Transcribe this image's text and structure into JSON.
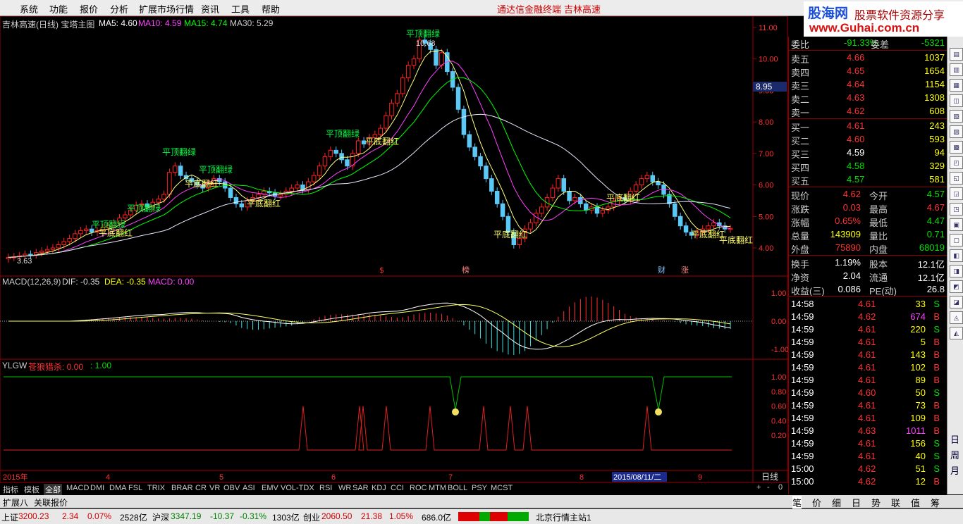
{
  "menu": {
    "items": [
      "系统",
      "功能",
      "报价",
      "分析",
      "扩展市场行情",
      "资讯",
      "工具",
      "帮助"
    ],
    "center_links": [
      "通达信金融终端",
      "吉林高速"
    ]
  },
  "logo": {
    "brand": "股海网",
    "slogan": "股票软件资源分享",
    "url": "www.Guhai.com.cn"
  },
  "chart": {
    "title": "吉林高速(日线) 宝塔主图",
    "ma": [
      {
        "label": "MA5: 4.60",
        "color": "#ffffff"
      },
      {
        "label": "MA10: 4.59",
        "color": "#ff40ff"
      },
      {
        "label": "MA15: 4.74",
        "color": "#00ff00"
      },
      {
        "label": "MA30: 5.29",
        "color": "#ffffff"
      }
    ],
    "price_axis": [
      "11.00",
      "10.00",
      "9.00",
      "8.00",
      "7.00",
      "6.00",
      "5.00",
      "4.00"
    ],
    "current_price_tag": "8.95",
    "high_label": "10.68",
    "low_label": "3.63",
    "annotations_top": [
      "平顶翻绿",
      "平顶翻绿",
      "平顶翻绿",
      "平顶翻绿",
      "平顶翻绿",
      "平顶翻绿"
    ],
    "annotations_bottom": [
      "平底翻红",
      "平底翻红",
      "平底翻红",
      "平底翻红",
      "平底翻红",
      "平底翻红",
      "平底翻红",
      "平底翻红"
    ],
    "event_marks": [
      "$",
      "榜",
      "财",
      "涨"
    ],
    "macd": {
      "label": "MACD(12,26,9)",
      "dif": "DIF: -0.35",
      "dea": "DEA: -0.35",
      "macd": "MACD: 0.00",
      "axis": [
        "1.00",
        "0.00",
        "-1.00"
      ]
    },
    "ylgw": {
      "label": "YLGW",
      "name": "苍狼猎杀: 0.00",
      "v2": ": 1.00",
      "axis": [
        "1.00",
        "0.80",
        "0.60",
        "0.40",
        "0.20"
      ]
    },
    "date_axis": {
      "labels": [
        "2015年",
        "4",
        "5",
        "6",
        "7",
        "8",
        "9"
      ],
      "cursor_date": "2015/08/11/二",
      "period": "日线"
    }
  },
  "quote": {
    "weibi": {
      "label": "委比",
      "value": "-91.33%",
      "label2": "委差",
      "value2": "-5321"
    },
    "asks": [
      {
        "label": "卖五",
        "price": "4.66",
        "vol": "1037"
      },
      {
        "label": "卖四",
        "price": "4.65",
        "vol": "1654"
      },
      {
        "label": "卖三",
        "price": "4.64",
        "vol": "1154"
      },
      {
        "label": "卖二",
        "price": "4.63",
        "vol": "1308"
      },
      {
        "label": "卖一",
        "price": "4.62",
        "vol": "608"
      }
    ],
    "bids": [
      {
        "label": "买一",
        "price": "4.61",
        "vol": "243"
      },
      {
        "label": "买二",
        "price": "4.60",
        "vol": "593"
      },
      {
        "label": "买三",
        "price": "4.59",
        "vol": "94"
      },
      {
        "label": "买四",
        "price": "4.58",
        "vol": "329"
      },
      {
        "label": "买五",
        "price": "4.57",
        "vol": "581"
      }
    ],
    "stats": [
      {
        "l1": "现价",
        "v1": "4.62",
        "l2": "今开",
        "v2": "4.57"
      },
      {
        "l1": "涨跌",
        "v1": "0.03",
        "l2": "最高",
        "v2": "4.67"
      },
      {
        "l1": "涨幅",
        "v1": "0.65%",
        "l2": "最低",
        "v2": "4.47"
      },
      {
        "l1": "总量",
        "v1": "143909",
        "l2": "量比",
        "v2": "0.71"
      },
      {
        "l1": "外盘",
        "v1": "75890",
        "l2": "内盘",
        "v2": "68019"
      }
    ],
    "stats2": [
      {
        "l1": "换手",
        "v1": "1.19%",
        "l2": "股本",
        "v2": "12.1亿"
      },
      {
        "l1": "净资",
        "v1": "2.04",
        "l2": "流通",
        "v2": "12.1亿"
      },
      {
        "l1": "收益(三)",
        "v1": "0.086",
        "l2": "PE(动)",
        "v2": "26.8"
      }
    ],
    "ticks": [
      {
        "t": "14:58",
        "p": "4.61",
        "v": "33",
        "s": "S"
      },
      {
        "t": "14:59",
        "p": "4.62",
        "v": "674",
        "s": "B"
      },
      {
        "t": "14:59",
        "p": "4.61",
        "v": "220",
        "s": "S"
      },
      {
        "t": "14:59",
        "p": "4.61",
        "v": "5",
        "s": "B"
      },
      {
        "t": "14:59",
        "p": "4.61",
        "v": "143",
        "s": "B"
      },
      {
        "t": "14:59",
        "p": "4.61",
        "v": "102",
        "s": "B"
      },
      {
        "t": "14:59",
        "p": "4.61",
        "v": "89",
        "s": "B"
      },
      {
        "t": "14:59",
        "p": "4.60",
        "v": "50",
        "s": "S"
      },
      {
        "t": "14:59",
        "p": "4.61",
        "v": "73",
        "s": "B"
      },
      {
        "t": "14:59",
        "p": "4.61",
        "v": "109",
        "s": "B"
      },
      {
        "t": "14:59",
        "p": "4.63",
        "v": "1011",
        "s": "B"
      },
      {
        "t": "14:59",
        "p": "4.61",
        "v": "156",
        "s": "S"
      },
      {
        "t": "14:59",
        "p": "4.61",
        "v": "40",
        "s": "S"
      },
      {
        "t": "15:00",
        "p": "4.62",
        "v": "51",
        "s": "S"
      },
      {
        "t": "15:00",
        "p": "4.62",
        "v": "12",
        "s": "B"
      }
    ]
  },
  "indicator_tabs": [
    "指标",
    "模板",
    "全部",
    "MACD",
    "DMI",
    "DMA",
    "FSL",
    "TRIX",
    "BRAR",
    "CR",
    "VR",
    "OBV",
    "ASI",
    "EMV",
    "VOL-TDX",
    "RSI",
    "WR",
    "SAR",
    "KDJ",
    "CCI",
    "ROC",
    "MTM",
    "BOLL",
    "PSY",
    "MCST"
  ],
  "tabs2": [
    "扩展八",
    "关联报价"
  ],
  "right_tabs": [
    "笔",
    "价",
    "细",
    "日",
    "势",
    "联",
    "值",
    "筹"
  ],
  "sidebar_text": [
    "日",
    "周",
    "月"
  ],
  "status": {
    "sh_label": "上证",
    "sh": "3200.23",
    "sh_chg": "2.34",
    "sh_pct": "0.07%",
    "sh_amt": "2528亿",
    "hs_label": "沪深",
    "hs": "3347.19",
    "hs_chg": "-10.37",
    "hs_pct": "-0.31%",
    "hs_amt": "1303亿",
    "cy_label": "创业",
    "cy": "2060.50",
    "cy_chg": "21.38",
    "cy_pct": "1.05%",
    "cy_amt": "686.0亿",
    "station": "北京行情主站1"
  }
}
